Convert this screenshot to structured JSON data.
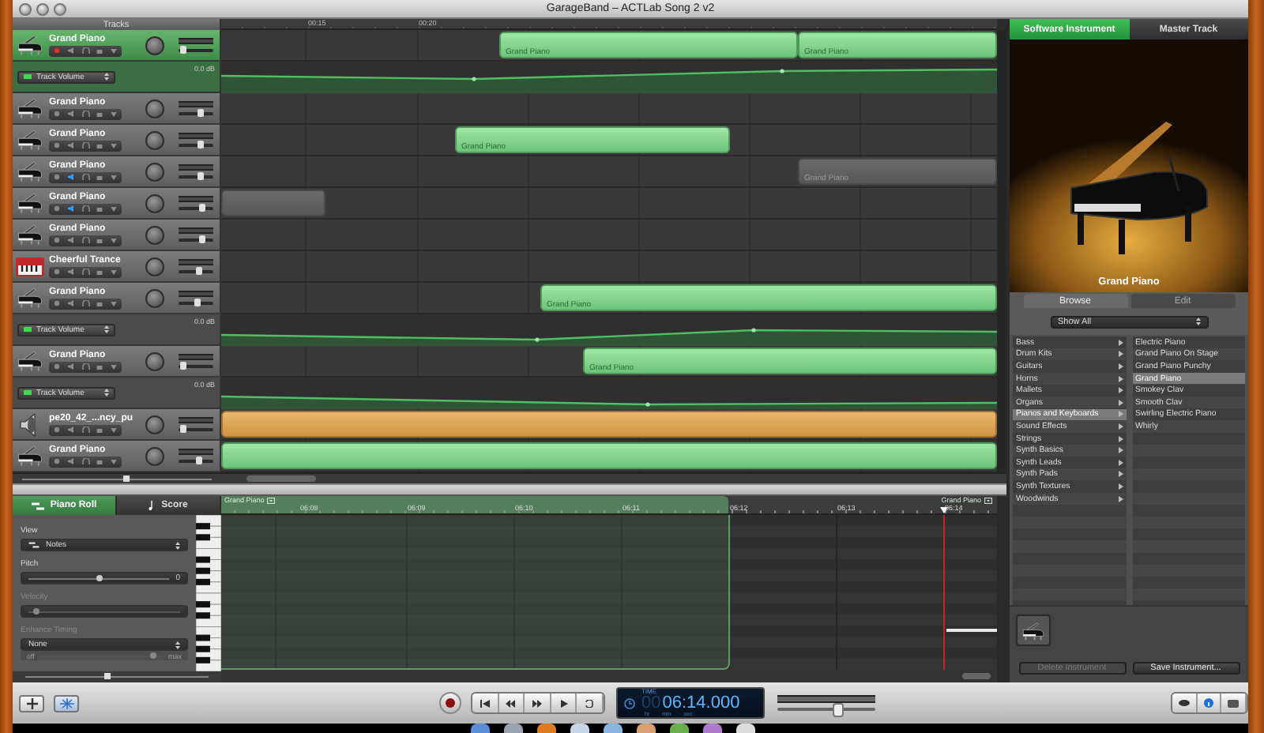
{
  "window": {
    "title": "GarageBand – ACTLab Song 2 v2"
  },
  "tracks_header": {
    "label": "Tracks"
  },
  "zoom_slider": {
    "level": 0.55
  },
  "ruler": {
    "ticks": [
      "00:15",
      "00:20"
    ]
  },
  "tracks": [
    {
      "kind": "instrument",
      "name": "Grand Piano",
      "selected": true,
      "record_enabled": true,
      "muted": false,
      "level": 0.15,
      "regions": [
        {
          "kind": "midi",
          "label": "Grand Piano"
        },
        {
          "kind": "midi",
          "label": "Grand Piano"
        }
      ]
    },
    {
      "kind": "automation",
      "parameter": "Track Volume",
      "enabled": true,
      "reading": "0.0 dB"
    },
    {
      "kind": "instrument",
      "name": "Grand Piano",
      "selected": false,
      "record_enabled": false,
      "muted": false,
      "level": 0.65
    },
    {
      "kind": "instrument",
      "name": "Grand Piano",
      "selected": false,
      "record_enabled": false,
      "muted": false,
      "level": 0.65,
      "regions": [
        {
          "kind": "midi",
          "label": "Grand Piano"
        }
      ]
    },
    {
      "kind": "instrument",
      "name": "Grand Piano",
      "selected": false,
      "record_enabled": false,
      "muted": true,
      "level": 0.65,
      "regions": [
        {
          "kind": "midi",
          "label": "Grand Piano"
        }
      ]
    },
    {
      "kind": "instrument",
      "name": "Grand Piano",
      "selected": false,
      "record_enabled": false,
      "muted": true,
      "level": 0.7,
      "regions": [
        {
          "kind": "midi"
        }
      ]
    },
    {
      "kind": "instrument",
      "name": "Grand Piano",
      "selected": false,
      "record_enabled": false,
      "muted": false,
      "level": 0.7
    },
    {
      "kind": "synth",
      "name": "Cheerful Trance",
      "selected": false,
      "record_enabled": false,
      "muted": false,
      "level": 0.6
    },
    {
      "kind": "instrument",
      "name": "Grand Piano",
      "selected": false,
      "record_enabled": false,
      "muted": false,
      "level": 0.55,
      "regions": [
        {
          "kind": "midi",
          "label": "Grand Piano"
        }
      ]
    },
    {
      "kind": "automation",
      "parameter": "Track Volume",
      "enabled": true,
      "reading": "0.0 dB"
    },
    {
      "kind": "instrument",
      "name": "Grand Piano",
      "selected": false,
      "record_enabled": false,
      "muted": false,
      "level": 0.15,
      "regions": [
        {
          "kind": "midi",
          "label": "Grand Piano"
        }
      ]
    },
    {
      "kind": "automation",
      "parameter": "Track Volume",
      "enabled": true,
      "reading": "0.0 dB"
    },
    {
      "kind": "audio",
      "name": "pe20_42_...ncy_pu",
      "selected": false,
      "record_enabled": false,
      "muted": false,
      "level": 0.15,
      "regions": [
        {
          "kind": "audio"
        }
      ]
    },
    {
      "kind": "instrument",
      "name": "Grand Piano",
      "selected": false,
      "record_enabled": false,
      "muted": false,
      "level": 0.6,
      "regions": [
        {
          "kind": "midi"
        }
      ]
    }
  ],
  "editor": {
    "zoom_slider": {
      "level": 0.45
    },
    "tabs": [
      {
        "label": "Piano Roll",
        "selected": true
      },
      {
        "label": "Score",
        "selected": false
      }
    ],
    "controls": [
      {
        "kind": "dropdown",
        "label": "View",
        "value": "Notes",
        "disabled": false
      },
      {
        "kind": "slider",
        "label": "Pitch",
        "level": 0.5,
        "reading": "0",
        "disabled": false
      },
      {
        "kind": "slider",
        "label": "Velocity",
        "level": 0.05,
        "disabled": true
      },
      {
        "kind": "timing",
        "label": "Enhance Timing",
        "value": "None",
        "level": 0.92,
        "min_label": "off",
        "max_label": "max",
        "disabled": true
      }
    ],
    "ruler": {
      "ticks": [
        "06:08",
        "06:09",
        "06:10",
        "06:11",
        "06:12",
        "06:13",
        "06:14"
      ]
    },
    "regions": [
      {
        "label": "Grand Piano"
      },
      {
        "label": "Grand Piano"
      }
    ]
  },
  "inspector": {
    "tabs": [
      {
        "label": "Software Instrument",
        "selected": true
      },
      {
        "label": "Master Track",
        "selected": false
      }
    ],
    "instrument_name": "Grand Piano",
    "view_tabs": [
      {
        "label": "Browse",
        "selected": true
      },
      {
        "label": "Edit",
        "selected": false
      }
    ],
    "filter": "Show All",
    "categories": [
      {
        "label": "Bass",
        "selected": false
      },
      {
        "label": "Drum Kits",
        "selected": false
      },
      {
        "label": "Guitars",
        "selected": false
      },
      {
        "label": "Horns",
        "selected": false
      },
      {
        "label": "Mallets",
        "selected": false
      },
      {
        "label": "Organs",
        "selected": false
      },
      {
        "label": "Pianos and Keyboards",
        "selected": true
      },
      {
        "label": "Sound Effects",
        "selected": false
      },
      {
        "label": "Strings",
        "selected": false
      },
      {
        "label": "Synth Basics",
        "selected": false
      },
      {
        "label": "Synth Leads",
        "selected": false
      },
      {
        "label": "Synth Pads",
        "selected": false
      },
      {
        "label": "Synth Textures",
        "selected": false
      },
      {
        "label": "Woodwinds",
        "selected": false
      }
    ],
    "instruments": [
      {
        "label": "Electric Piano",
        "selected": false
      },
      {
        "label": "Grand Piano On Stage",
        "selected": false
      },
      {
        "label": "Grand Piano Punchy",
        "selected": false
      },
      {
        "label": "Grand Piano",
        "selected": true
      },
      {
        "label": "Smokey Clav",
        "selected": false
      },
      {
        "label": "Smooth Clav",
        "selected": false
      },
      {
        "label": "Swirling Electric Piano",
        "selected": false
      },
      {
        "label": "Whirly",
        "selected": false
      }
    ],
    "buttons": [
      {
        "label": "Delete Instrument",
        "disabled": true
      },
      {
        "label": "Save Instrument...",
        "disabled": false
      }
    ]
  },
  "transport": {
    "lcd": {
      "label": "TIME",
      "hours": "00",
      "time": "06:14.000",
      "units": [
        "hr",
        "min",
        "sec"
      ]
    },
    "master_volume": {
      "level": 0.62
    }
  }
}
